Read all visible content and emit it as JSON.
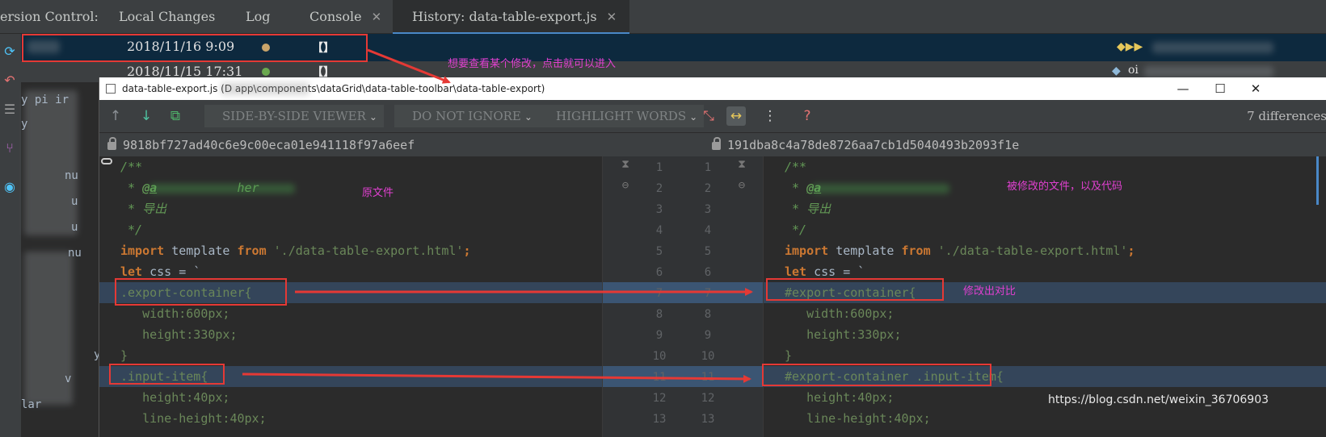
{
  "tabbar": {
    "label": "ersion Control:",
    "tabs": [
      {
        "label": "Local Changes"
      },
      {
        "label": "Log"
      },
      {
        "label": "Console"
      },
      {
        "label": "History: data-table-export.js"
      }
    ],
    "close_glyph": "✕"
  },
  "history": {
    "rows": [
      {
        "date": "2018/11/16 9:09",
        "message": "【】",
        "dot_color": "#c9a46a"
      },
      {
        "date": "2018/11/15 17:31",
        "message": "【】",
        "dot_color": "#6aa84f"
      }
    ],
    "row2_tag": "oi"
  },
  "left_fragments": [
    "y pi  ir",
    "y",
    "nu",
    "u",
    "u",
    "nu",
    "y",
    "v",
    "lar"
  ],
  "diff": {
    "title": "data-table-export.js (D                    app\\components\\dataGrid\\data-table-toolbar\\data-table-export)",
    "window_buttons": {
      "minimize": "—",
      "maximize": "☐",
      "close": "✕"
    },
    "toolbar": {
      "viewer": "SIDE-BY-SIDE VIEWER",
      "ignore": "DO NOT IGNORE",
      "highlight": "HIGHLIGHT WORDS",
      "chevron": "⌄",
      "differences": "7 differences"
    },
    "left_hash": "9818bf727ad40c6e9c00eca01e941118f97a6eef",
    "right_hash": "191dba8c4a78de8726aa7cb1d5040493b2093f1e",
    "line_numbers": [
      "1",
      "2",
      "3",
      "4",
      "5",
      "6",
      "7",
      "8",
      "9",
      "10",
      "11",
      "12",
      "13"
    ],
    "code": {
      "l1": "/**",
      "l2_star": " * ",
      "l2_tag": "@a",
      "l2_tail": "           her",
      "l3": " * 导出",
      "l4": " */",
      "import_kw": "import",
      "import_mid": " template ",
      "from_kw": "from",
      "import_str": " './data-table-export.html'",
      "semicolon": ";",
      "let_kw": "let",
      "let_rest": " css = `",
      "left_l7": ".export-container{",
      "right_l7": "#export-container{",
      "l8": "   width:600px;",
      "l9": "   height:330px;",
      "l10": "}",
      "left_l11": ".input-item{",
      "right_l11": "#export-container .input-item{",
      "l12": "   height:40px;",
      "l13": "   line-height:40px;"
    }
  },
  "annotations": {
    "history_hint": "想要查看某个修改，点击就可以进入",
    "original": "原文件",
    "modified": "被修改的文件，以及代码",
    "compare": "修改出对比"
  },
  "watermark": "https://blog.csdn.net/weixin_36706903",
  "colors": {
    "annotation": "#e040d0",
    "box": "#e53935",
    "selected_row": "#0d293e",
    "changed_line": "#34455a"
  }
}
